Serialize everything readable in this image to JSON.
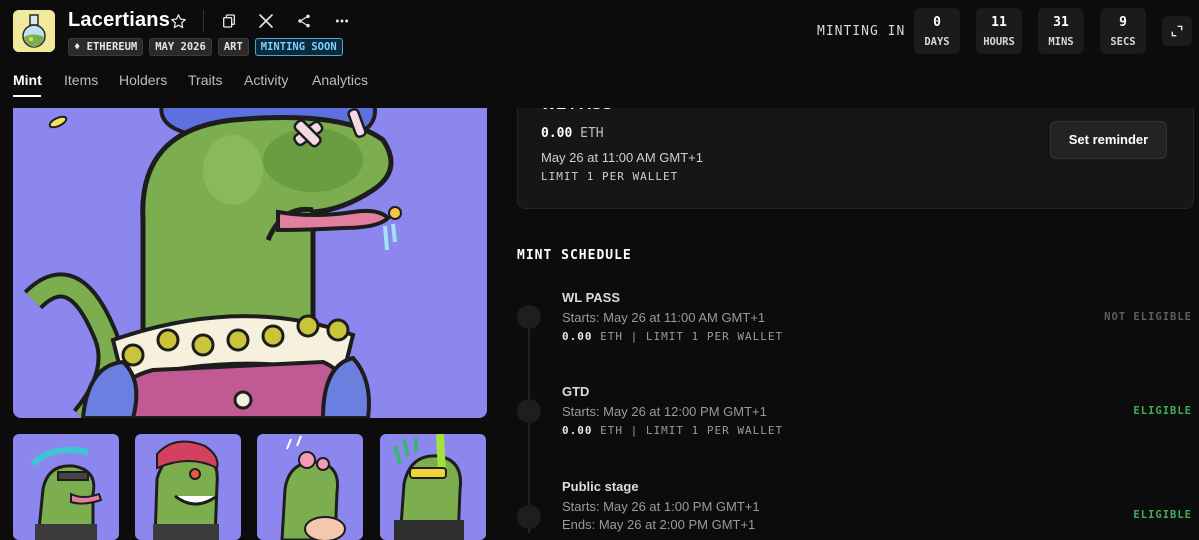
{
  "collection": {
    "name": "Lacertians",
    "badges": {
      "chain": "ETHEREUM",
      "date": "MAY 2026",
      "category": "ART",
      "status": "MINTING SOON"
    }
  },
  "countdown": {
    "label": "MINTING IN",
    "days": "0",
    "days_unit": "DAYS",
    "hours": "11",
    "hours_unit": "HOURS",
    "mins": "31",
    "mins_unit": "MINS",
    "secs": "9",
    "secs_unit": "SECS"
  },
  "tabs": [
    "Mint",
    "Items",
    "Holders",
    "Traits",
    "Activity",
    "Analytics"
  ],
  "current_stage": {
    "name": "WL PASS",
    "price": "0.00",
    "currency": "ETH",
    "date": "May 26 at 11:00 AM GMT+1",
    "limit": "LIMIT 1 PER WALLET",
    "button": "Set reminder"
  },
  "schedule": {
    "title": "MINT SCHEDULE",
    "phases": [
      {
        "name": "WL PASS",
        "starts": "Starts: May 26 at 11:00 AM GMT+1",
        "price": "0.00",
        "details": "ETH | LIMIT 1 PER WALLET",
        "status": "NOT ELIGIBLE"
      },
      {
        "name": "GTD",
        "starts": "Starts: May 26 at 12:00 PM GMT+1",
        "price": "0.00",
        "details": "ETH | LIMIT 1 PER WALLET",
        "status": "ELIGIBLE"
      },
      {
        "name": "Public stage",
        "starts": "Starts: May 26 at 1:00 PM GMT+1",
        "ends": "Ends: May 26 at 2:00 PM GMT+1",
        "status": "ELIGIBLE"
      }
    ]
  },
  "colors": {
    "background": "#0c0c0c",
    "eligible": "#3fae5a",
    "not_eligible": "#5e5e5e",
    "minting_soon": "#4aa8d8",
    "art_bg": "#8c86ef",
    "lizard_green": "#7cae4f"
  }
}
